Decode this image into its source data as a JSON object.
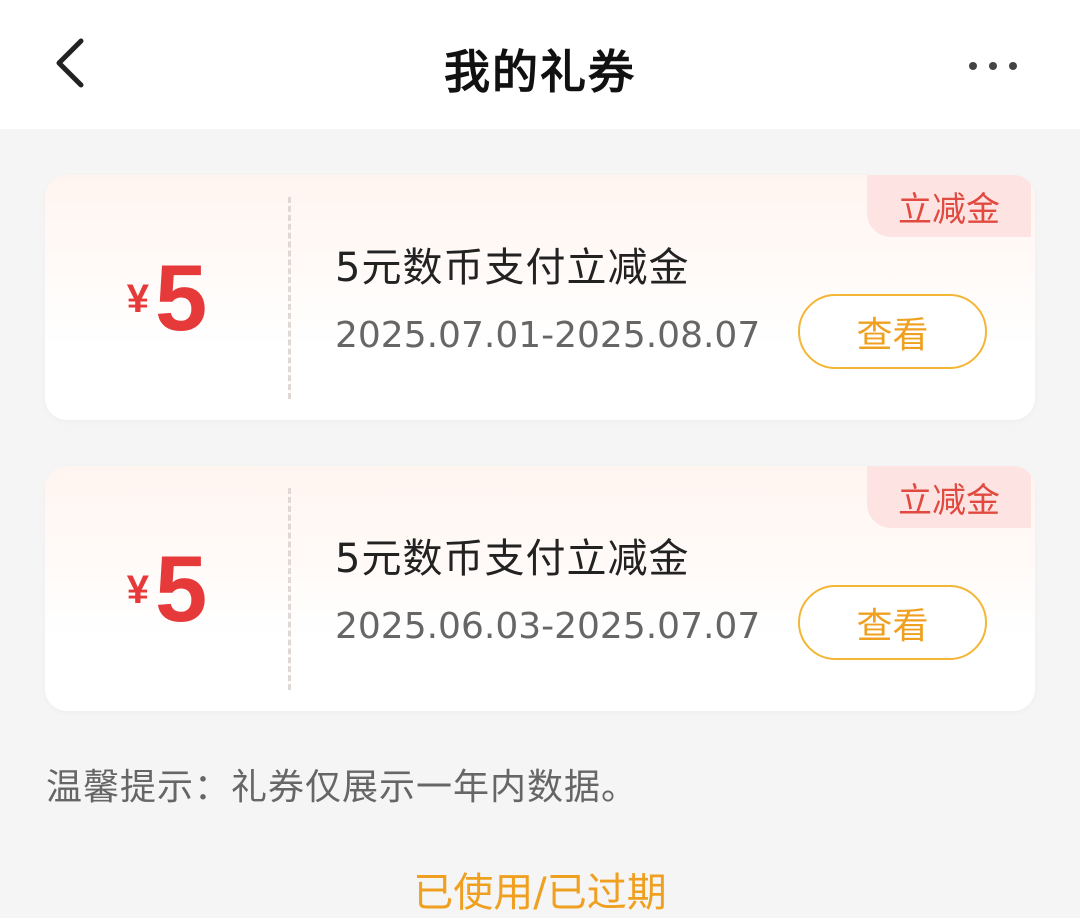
{
  "header": {
    "title": "我的礼券",
    "back_icon": "chevron-left-icon",
    "more_icon": "more-horizontal-icon"
  },
  "coupons": [
    {
      "currency": "¥",
      "amount": "5",
      "name": "5元数币支付立减金",
      "date_range": "2025.07.01-2025.08.07",
      "action_label": "查看",
      "tag": "立减金"
    },
    {
      "currency": "¥",
      "amount": "5",
      "name": "5元数币支付立减金",
      "date_range": "2025.06.03-2025.07.07",
      "action_label": "查看",
      "tag": "立减金"
    }
  ],
  "tip": "温馨提示：礼券仅展示一年内数据。",
  "used_expired_link": "已使用/已过期",
  "colors": {
    "amount": "#e63a3a",
    "accent": "#f0a020",
    "tag_bg": "#fde4e2",
    "page_bg": "#f5f5f5"
  }
}
